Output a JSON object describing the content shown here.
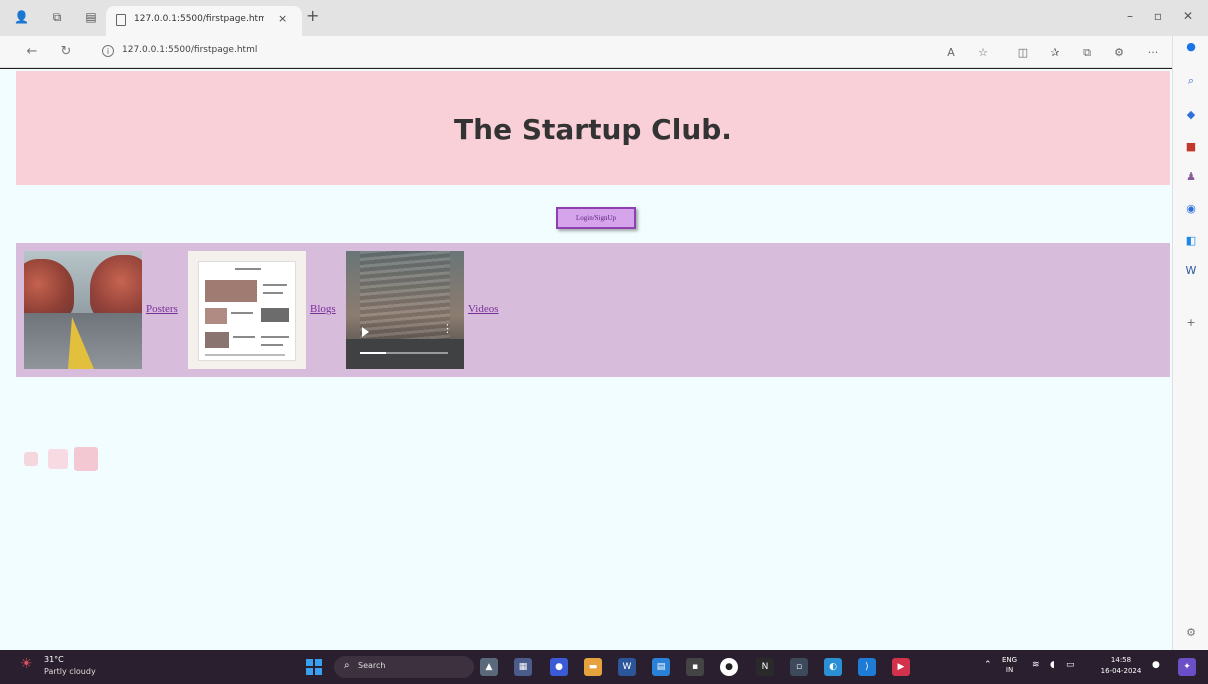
{
  "browser": {
    "tab_title": "127.0.0.1:5500/firstpage.html",
    "tab_close": "×",
    "new_tab": "+",
    "url": "127.0.0.1:5500/firstpage.html"
  },
  "page": {
    "title": "The Startup Club.",
    "login_button": "Login/SignUp",
    "links": {
      "posters": "Posters",
      "blogs": "Blogs",
      "videos": "Videos"
    },
    "video_progress": 0.3
  },
  "taskbar": {
    "weather_temp": "31°C",
    "weather_desc": "Partly cloudy",
    "search_label": "Search",
    "lang": "ENG",
    "lang_sub": "IN",
    "time": "14:58",
    "date": "16-04-2024"
  },
  "colors": {
    "header_bg": "#f9d0d8",
    "page_bg": "#f1fdfe",
    "band_bg": "#d7bcdc",
    "login_bg": "#d6a4ea",
    "link": "#7a2e9a"
  }
}
